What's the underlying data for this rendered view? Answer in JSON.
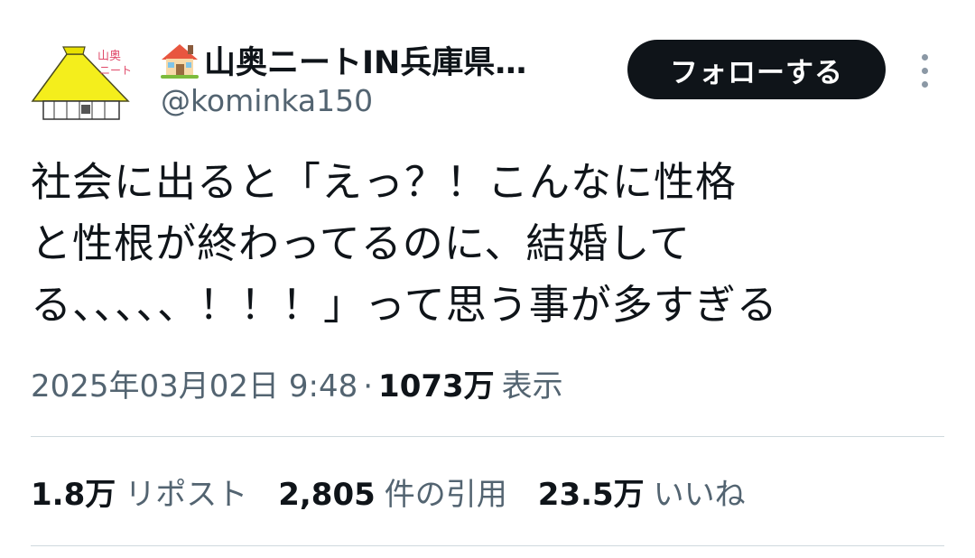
{
  "user": {
    "display_name": "山奥ニートIN兵庫県…",
    "handle": "@kominka150",
    "name_icon": "house-emoji-icon",
    "avatar_text_line1": "山奥",
    "avatar_text_line2": "ニート"
  },
  "actions": {
    "follow_label": "フォローする",
    "more_icon": "vertical-ellipsis-icon"
  },
  "tweet": {
    "lines": [
      "社会に出ると「えっ？！こんなに性格",
      "と性根が終わってるのに、結婚して",
      "る、、、、、！！！」って思う事が多すぎる"
    ]
  },
  "meta": {
    "timestamp": "2025年03月02日 9:48",
    "separator": "·",
    "views_count": "1073万",
    "views_label": "表示"
  },
  "stats": [
    {
      "count": "1.8万",
      "label": "リポスト"
    },
    {
      "count": "2,805",
      "label": "件の引用"
    },
    {
      "count": "23.5万",
      "label": "いいね"
    }
  ],
  "colors": {
    "text_primary": "#0f1419",
    "text_secondary": "#536471",
    "divider": "#cfd9de",
    "follow_bg": "#0f1419",
    "avatar_roof": "#f4ee1c"
  }
}
